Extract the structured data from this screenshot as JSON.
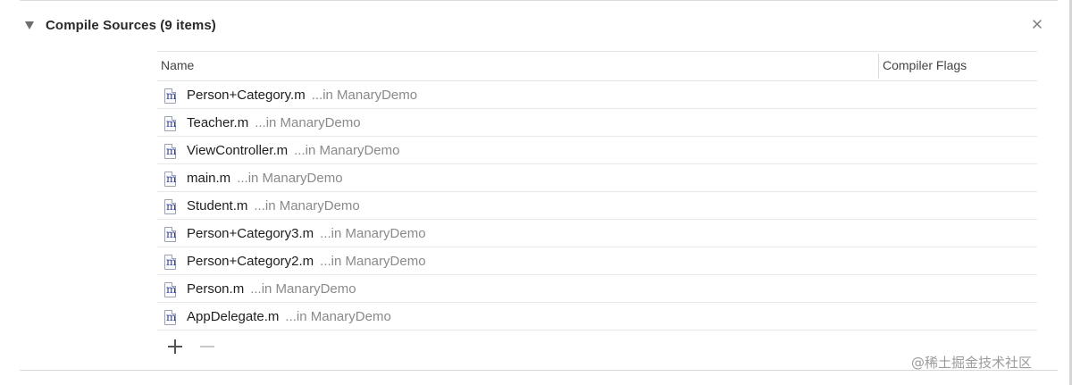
{
  "phase": {
    "title": "Compile Sources (9 items)",
    "close_icon": "close-icon",
    "disclosure_icon": "disclosure-triangle-icon"
  },
  "table": {
    "columns": {
      "name": "Name",
      "flags": "Compiler Flags"
    },
    "rows": [
      {
        "file": "Person+Category.m",
        "location": "...in ManaryDemo",
        "flags": ""
      },
      {
        "file": "Teacher.m",
        "location": "...in ManaryDemo",
        "flags": ""
      },
      {
        "file": "ViewController.m",
        "location": "...in ManaryDemo",
        "flags": ""
      },
      {
        "file": "main.m",
        "location": "...in ManaryDemo",
        "flags": ""
      },
      {
        "file": "Student.m",
        "location": "...in ManaryDemo",
        "flags": ""
      },
      {
        "file": "Person+Category3.m",
        "location": "...in ManaryDemo",
        "flags": ""
      },
      {
        "file": "Person+Category2.m",
        "location": "...in ManaryDemo",
        "flags": ""
      },
      {
        "file": "Person.m",
        "location": "...in ManaryDemo",
        "flags": ""
      },
      {
        "file": "AppDelegate.m",
        "location": "...in ManaryDemo",
        "flags": ""
      }
    ],
    "file_icon_glyph": "m"
  },
  "controls": {
    "add_icon": "plus-icon",
    "remove_icon": "minus-icon"
  },
  "watermark": "@稀土掘金技术社区"
}
